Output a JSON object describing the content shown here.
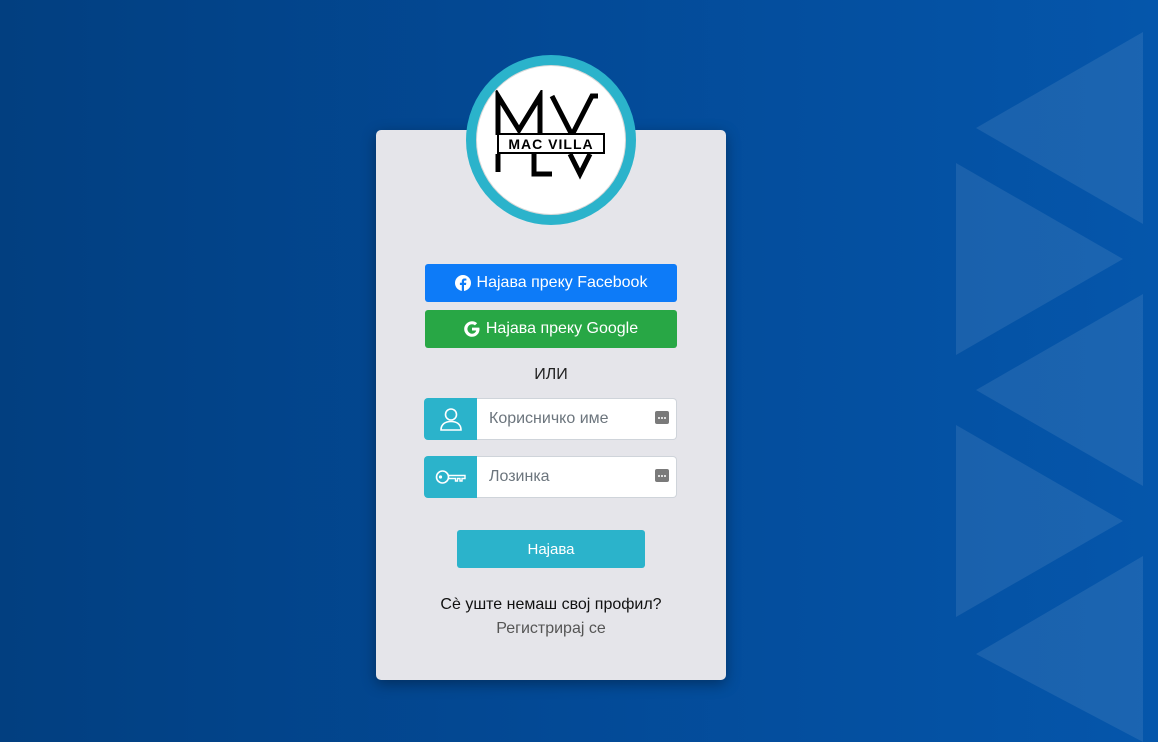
{
  "brand": {
    "logo_monogram": "MV",
    "logo_text": "MAC VILLA"
  },
  "social": {
    "facebook_label": "Најава преку Facebook",
    "google_label": "Најава преку Google"
  },
  "divider": {
    "or_label": "ИЛИ"
  },
  "form": {
    "username_placeholder": "Корисничко име",
    "username_value": "",
    "password_placeholder": "Лозинка",
    "password_value": "",
    "submit_label": "Најава"
  },
  "footer": {
    "no_profile_text": "Сè уште немаш свој профил?",
    "register_link": "Регистрирај се"
  },
  "colors": {
    "accent": "#2bb3cb",
    "facebook": "#0d7bf8",
    "google": "#28a745",
    "card_bg": "#e5e5ea"
  },
  "icons": {
    "facebook": "facebook-icon",
    "google": "google-icon",
    "user": "user-icon",
    "key": "key-icon",
    "password_manager": "password-manager-icon"
  }
}
